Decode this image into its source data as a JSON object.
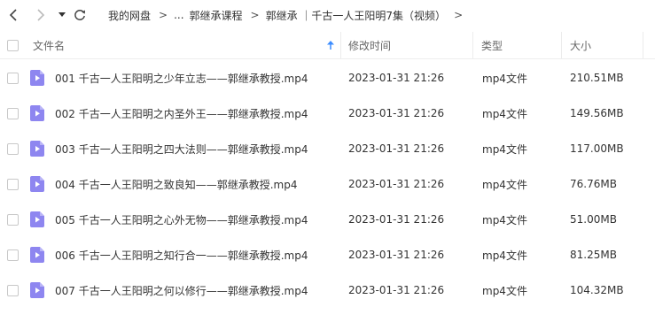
{
  "toolbar": {
    "back_icon": "chevron-left-icon",
    "forward_icon": "chevron-right-icon",
    "dropdown_icon": "caret-down-icon",
    "refresh_icon": "refresh-icon"
  },
  "breadcrumb": {
    "items": [
      "我的网盘",
      "...",
      "郭继承课程",
      "郭继承 ｜千古一人王阳明7集（视频）"
    ],
    "separator": ">"
  },
  "table": {
    "columns": {
      "name": "文件名",
      "modified": "修改时间",
      "type": "类型",
      "size": "大小"
    },
    "sort_icon": "sort-up-arrow-icon",
    "accent_color": "#3b8cff",
    "file_icon_color": "#8e86f0",
    "rows": [
      {
        "name": "001 千古一人王阳明之少年立志——郭继承教授.mp4",
        "modified": "2023-01-31 21:26",
        "type": "mp4文件",
        "size": "210.51MB"
      },
      {
        "name": "002 千古一人王阳明之内圣外王——郭继承教授.mp4",
        "modified": "2023-01-31 21:26",
        "type": "mp4文件",
        "size": "149.56MB"
      },
      {
        "name": "003 千古一人王阳明之四大法则——郭继承教授.mp4",
        "modified": "2023-01-31 21:26",
        "type": "mp4文件",
        "size": "117.00MB"
      },
      {
        "name": "004 千古一人王阳明之致良知——郭继承教授.mp4",
        "modified": "2023-01-31 21:26",
        "type": "mp4文件",
        "size": "76.76MB"
      },
      {
        "name": "005 千古一人王阳明之心外无物——郭继承教授.mp4",
        "modified": "2023-01-31 21:26",
        "type": "mp4文件",
        "size": "51.00MB"
      },
      {
        "name": "006 千古一人王阳明之知行合一——郭继承教授.mp4",
        "modified": "2023-01-31 21:26",
        "type": "mp4文件",
        "size": "81.25MB"
      },
      {
        "name": "007 千古一人王阳明之何以修行——郭继承教授.mp4",
        "modified": "2023-01-31 21:26",
        "type": "mp4文件",
        "size": "104.32MB"
      }
    ]
  }
}
